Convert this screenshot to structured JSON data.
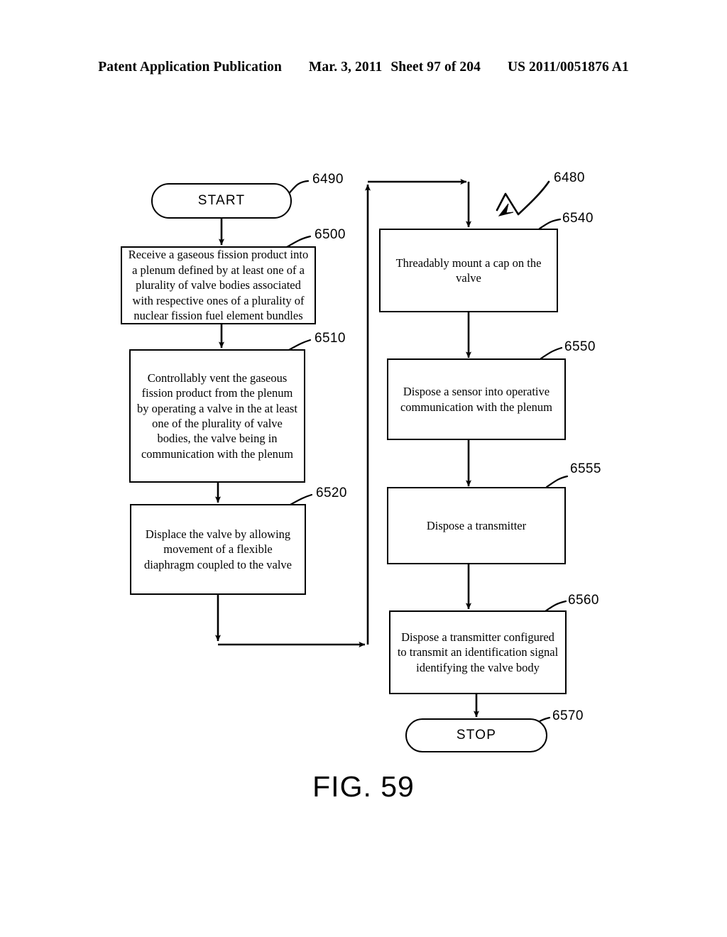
{
  "header": {
    "publication": "Patent Application Publication",
    "date": "Mar. 3, 2011",
    "sheet": "Sheet 97 of 204",
    "patent_number": "US 2011/0051876 A1"
  },
  "figure": {
    "caption": "FIG. 59",
    "overall_ref": "6480"
  },
  "nodes": {
    "start": {
      "label": "START",
      "ref": "6490"
    },
    "step_6500": {
      "label": "Receive a gaseous fission product into a plenum defined by at least one of a plurality of valve bodies associated with respective ones of a plurality of nuclear fission fuel element bundles",
      "ref": "6500"
    },
    "step_6510": {
      "label": "Controllably vent the gaseous fission product from the plenum by operating a valve in the at least one of the plurality of valve bodies, the valve being in communication with the plenum",
      "ref": "6510"
    },
    "step_6520": {
      "label": "Displace the valve by allowing movement of a flexible diaphragm coupled to the valve",
      "ref": "6520"
    },
    "step_6540": {
      "label": "Threadably mount a cap on the valve",
      "ref": "6540"
    },
    "step_6550": {
      "label": "Dispose a sensor into operative communication with the plenum",
      "ref": "6550"
    },
    "step_6555": {
      "label": "Dispose a transmitter",
      "ref": "6555"
    },
    "step_6560": {
      "label": "Dispose a transmitter configured to transmit an identification signal identifying the valve body",
      "ref": "6560"
    },
    "stop": {
      "label": "STOP",
      "ref": "6570"
    }
  },
  "colors": {
    "ink": "#000000",
    "paper": "#ffffff"
  }
}
